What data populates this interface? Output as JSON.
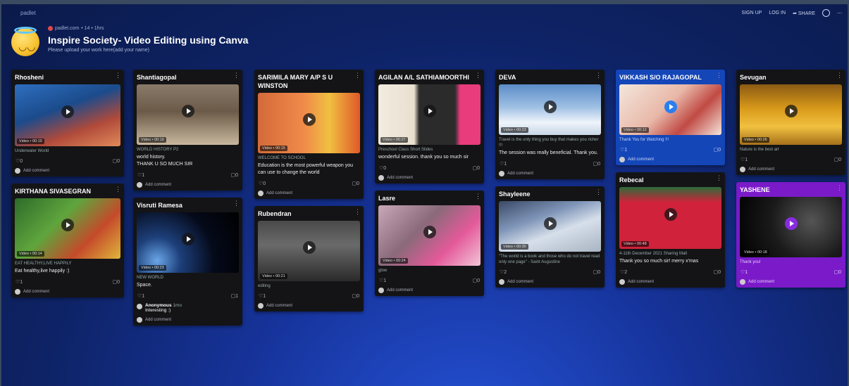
{
  "app": {
    "brand": "padlet"
  },
  "topbar": {
    "sign_up": "SIGN UP",
    "log_in": "LOG IN",
    "share": "SHARE"
  },
  "board": {
    "meta_author": "padlet.com",
    "meta_extra": "• 14 • 1hrs",
    "title": "Inspire Society- Video Editing using Canva",
    "subtitle": "Please upload your work here(add your name)"
  },
  "cards": {
    "c1": {
      "title": "Rhosheni",
      "badge": "Video • 00:19",
      "caption": "Underwater World",
      "likes": "0",
      "comments": "0",
      "add": "Add comment"
    },
    "c2": {
      "title": "KIRTHANA SIVASEGRAN",
      "badge": "Video • 00:14",
      "caption": "EAT HEALTHY,LIVE HAPPILY",
      "body": "Eat healthy,live happily :)",
      "likes": "1",
      "comments": "0",
      "add": "Add comment"
    },
    "c3": {
      "title": "Shantiagopal",
      "badge": "Video • 00:19",
      "caption": "WORLD HISTORY P2",
      "body": "world history.\nTHANK U SO MUCH SIR",
      "likes": "1",
      "comments": "0",
      "add": "Add comment"
    },
    "c4": {
      "title": "Visruti Ramesa",
      "badge": "Video • 00:23",
      "caption": "NEW WORLD",
      "body": "Space.",
      "likes": "1",
      "comments": "1",
      "anon_name": "Anonymous",
      "anon_time": "1mo",
      "anon_text": "Interesting :)",
      "add": "Add comment"
    },
    "c5": {
      "title": "SARIMILA MARY A/P S U WINSTON",
      "badge": "Video • 00:15",
      "caption": "WELCOME TO SCHOOL",
      "body": "Education is the most powerful weapon you can use to change the world",
      "likes": "0",
      "comments": "0",
      "add": "Add comment"
    },
    "c6": {
      "title": "Rubendran",
      "badge": "Video • 00:21",
      "caption": "editing",
      "likes": "1",
      "comments": "0",
      "add": "Add comment"
    },
    "c7": {
      "title": "AGILAN A/L SATHIAMOORTHI",
      "badge": "Video • 00:27",
      "caption": "Preschool Class Short Slides",
      "body": "wonderful session. thank you so much sir",
      "likes": "0",
      "comments": "0",
      "add": "Add comment"
    },
    "c8": {
      "title": "Lasre",
      "badge": "Video • 00:24",
      "caption": "glow",
      "likes": "1",
      "comments": "0",
      "add": "Add comment"
    },
    "c9": {
      "title": "DEVA",
      "badge": "Video • 00:23",
      "caption": "Travel is the only thing you buy that makes you richer !!!",
      "body": "The session was really beneficial. Thank you.",
      "likes": "1",
      "comments": "0",
      "add": "Add comment"
    },
    "c10": {
      "title": "Shayleene",
      "badge": "Video • 00:30",
      "caption": "\"The world is a book and those who do not travel read only one page\" - Saint Augustine",
      "likes": "2",
      "comments": "0",
      "add": "Add comment"
    },
    "c11": {
      "title": "VIKKASH S/O RAJAGOPAL",
      "badge": "Video • 00:12",
      "caption": "Thank You for Watching !!!",
      "likes": "1",
      "comments": "0",
      "add": "Add comment"
    },
    "c12": {
      "title": "Rebecal",
      "badge": "Video • 00:48",
      "caption": "4-11th December 2021 Sharing Mall",
      "body": "Thank you so much sir! merry x'mas",
      "likes": "2",
      "comments": "0",
      "add": "Add comment"
    },
    "c13": {
      "title": "Sevugan",
      "badge": "Video • 00:26",
      "caption": "Nature is the best art",
      "likes": "1",
      "comments": "0",
      "add": "Add comment"
    },
    "c14": {
      "title": "YASHENE",
      "badge": "Video • 00:18",
      "caption": "Thank you!",
      "likes": "1",
      "comments": "0",
      "add": "Add comment"
    }
  },
  "colors": {
    "blue_card": "#1446b8",
    "purple_card": "#7a1ac9",
    "card": "#141416"
  }
}
